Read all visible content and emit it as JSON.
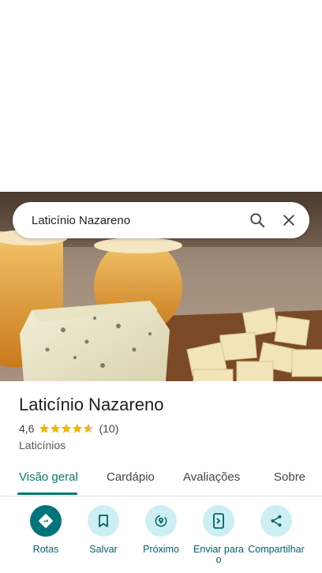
{
  "search": {
    "query": "Laticínio Nazareno"
  },
  "place": {
    "name": "Laticínio Nazareno",
    "rating": "4,6",
    "rating_value": 4.6,
    "review_count": "(10)",
    "category": "Laticínios"
  },
  "tabs": [
    "Visão geral",
    "Cardápio",
    "Avaliações",
    "Sobre"
  ],
  "actions": [
    {
      "label": "Rotas",
      "icon": "directions-icon"
    },
    {
      "label": "Salvar",
      "icon": "bookmark-icon"
    },
    {
      "label": "Próximo",
      "icon": "nearby-icon"
    },
    {
      "label": "Enviar para o",
      "icon": "send-to-phone-icon"
    },
    {
      "label": "Compartilhar",
      "icon": "share-icon"
    }
  ],
  "colors": {
    "accent": "#00796b",
    "star": "#f4b400",
    "action_bg": "#cdeff4",
    "primary_action_bg": "#00747a"
  }
}
